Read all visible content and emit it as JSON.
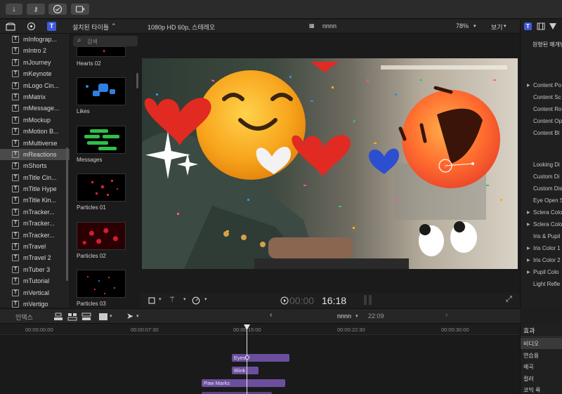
{
  "toolbar": {
    "import_icon": "down-arrow-icon",
    "keywords_icon": "key-icon",
    "background_tasks_icon": "checkmark-circle-icon",
    "share_icon": "share-icon"
  },
  "header": {
    "browser_title": "설치된 타이틀",
    "format": "1080p HD 60p, 스테레오",
    "project_name": "nnnn",
    "zoom": "78%",
    "view_menu": "보기"
  },
  "library": {
    "items": [
      {
        "label": "mInfograp...",
        "selected": false
      },
      {
        "label": "mIntro 2",
        "selected": false
      },
      {
        "label": "mJourney",
        "selected": false
      },
      {
        "label": "mKeynote",
        "selected": false
      },
      {
        "label": "mLogo Cin...",
        "selected": false
      },
      {
        "label": "mMatrix",
        "selected": false
      },
      {
        "label": "mMessage...",
        "selected": false
      },
      {
        "label": "mMockup",
        "selected": false
      },
      {
        "label": "mMotion B...",
        "selected": false
      },
      {
        "label": "mMultiverse",
        "selected": false
      },
      {
        "label": "mReactions",
        "selected": true
      },
      {
        "label": "mShorts",
        "selected": false
      },
      {
        "label": "mTitle Cin...",
        "selected": false
      },
      {
        "label": "mTitle Hype",
        "selected": false
      },
      {
        "label": "mTitle Kin...",
        "selected": false
      },
      {
        "label": "mTracker...",
        "selected": false
      },
      {
        "label": "mTracker...",
        "selected": false
      },
      {
        "label": "mTracker...",
        "selected": false
      },
      {
        "label": "mTravel",
        "selected": false
      },
      {
        "label": "mTravel 2",
        "selected": false
      },
      {
        "label": "mTuber 3",
        "selected": false
      },
      {
        "label": "mTutorial",
        "selected": false
      },
      {
        "label": "mVertical",
        "selected": false
      },
      {
        "label": "mVertigo",
        "selected": false
      }
    ]
  },
  "browser": {
    "search_placeholder": "검색",
    "tiles": [
      {
        "label": "Hearts 02"
      },
      {
        "label": "Likes"
      },
      {
        "label": "Messages"
      },
      {
        "label": "Particles 01"
      },
      {
        "label": "Particles 02"
      },
      {
        "label": "Particles 03"
      }
    ]
  },
  "viewer": {
    "timecode_dim": "00:00",
    "timecode": "16:18"
  },
  "inspector": {
    "title": "원형된 매개변",
    "rows": [
      {
        "label": "Content Po",
        "expandable": true
      },
      {
        "label": "Content Sc",
        "expandable": false
      },
      {
        "label": "Content Ro",
        "expandable": false
      },
      {
        "label": "Content Op",
        "expandable": false
      },
      {
        "label": "Content Bl",
        "expandable": false
      },
      {
        "label": "Looking Di",
        "expandable": false
      },
      {
        "label": "Custom Di",
        "expandable": false
      },
      {
        "label": "Custom Dis",
        "expandable": false
      },
      {
        "label": "Eye Open S",
        "expandable": false
      },
      {
        "label": "Sclera Colo",
        "expandable": true
      },
      {
        "label": "Sclera Colo",
        "expandable": true
      },
      {
        "label": "Iris & Pupil",
        "expandable": false
      },
      {
        "label": "Iris Color 1",
        "expandable": true
      },
      {
        "label": "Iris Color 2",
        "expandable": true
      },
      {
        "label": "Pupil Colo",
        "expandable": true
      },
      {
        "label": "Light Refle",
        "expandable": false
      }
    ]
  },
  "timeline_bar": {
    "index_label": "인덱스",
    "project_name": "nnnn",
    "duration": "22:09"
  },
  "ruler": {
    "ticks": [
      "00:00:00:00",
      "00:00:07:30",
      "00:00:15:00",
      "00:00:22:30",
      "00:00:30:00"
    ]
  },
  "clips": [
    {
      "label": "Eyes"
    },
    {
      "label": "Blink"
    },
    {
      "label": "Paw Marks"
    }
  ],
  "effects": {
    "title": "효과",
    "rows": [
      {
        "label": "비디오",
        "selected": true
      },
      {
        "label": "연습용",
        "selected": false
      },
      {
        "label": "왜곡",
        "selected": false
      },
      {
        "label": "컬러",
        "selected": false
      },
      {
        "label": "코믹 룩",
        "selected": false
      }
    ]
  },
  "colors": {
    "clip": "#6b4f9e",
    "selection": "#4a4a4a",
    "inspector_accent": "#3d5bd9"
  }
}
